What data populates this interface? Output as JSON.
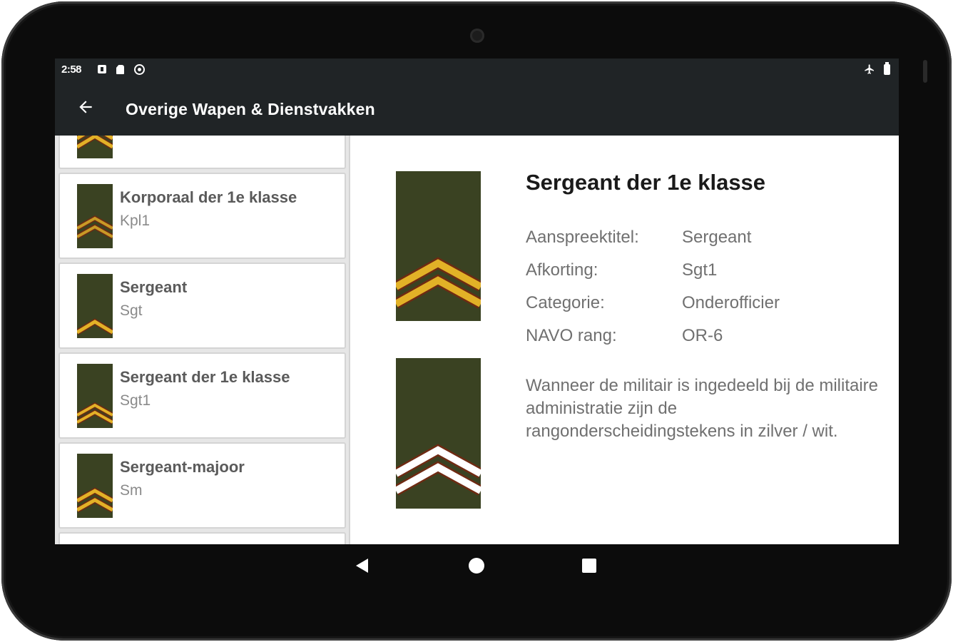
{
  "status_bar": {
    "time": "2:58",
    "icons": [
      "notification-icon",
      "sd-card-icon",
      "sync-icon",
      "airplane-mode-icon",
      "battery-icon"
    ]
  },
  "app_bar": {
    "title": "Overige Wapen & Dienstvakken",
    "back_icon": "arrow-left-icon"
  },
  "rank_list": [
    {
      "title": "Korporaal der 1e klasse",
      "abbr": "Kpl1",
      "insignia": "two-gold-chevrons"
    },
    {
      "title": "Sergeant",
      "abbr": "Sgt",
      "insignia": "one-gold-chevron"
    },
    {
      "title": "Sergeant der 1e klasse",
      "abbr": "Sgt1",
      "insignia": "two-gold-chevrons"
    },
    {
      "title": "Sergeant-majoor",
      "abbr": "Sm",
      "insignia": "two-gold-chevrons"
    }
  ],
  "detail": {
    "title": "Sergeant der 1e klasse",
    "rows": [
      {
        "label": "Aanspreektitel:",
        "value": "Sergeant"
      },
      {
        "label": "Afkorting:",
        "value": "Sgt1"
      },
      {
        "label": "Categorie:",
        "value": "Onderofficier"
      },
      {
        "label": "NAVO rang:",
        "value": "OR-6"
      }
    ],
    "note": "Wanneer de militair is ingedeeld bij de militaire administratie zijn de rangonderscheidingstekens in zilver / wit."
  },
  "colors": {
    "bar_background": "#202426",
    "insignia_olive": "#3a4222",
    "chevron_gold": "#e2b127",
    "chevron_edge": "#6e2a12",
    "chevron_silver": "#ffffff"
  },
  "nav_bar": {
    "icons": [
      "back-triangle-icon",
      "home-circle-icon",
      "recents-square-icon"
    ]
  }
}
